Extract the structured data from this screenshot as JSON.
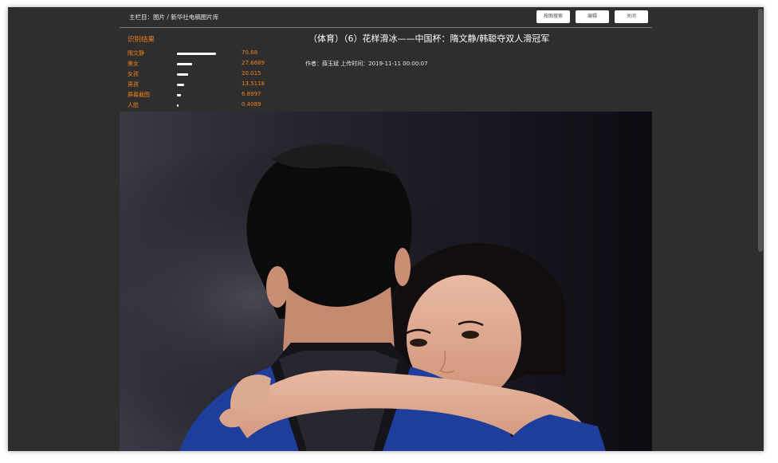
{
  "header": {
    "breadcrumb": "主栏目：图片 / 新华社电稿图片库",
    "buttons": {
      "search": "按图搜索",
      "edit": "编辑",
      "close": "关闭"
    }
  },
  "recognition": {
    "title": "识别结果",
    "items": [
      {
        "label": "隋文静",
        "value": "70.68",
        "score": 0.7068
      },
      {
        "label": "美女",
        "value": "27.6689",
        "score": 0.276689
      },
      {
        "label": "女孩",
        "value": "20.015",
        "score": 0.20015
      },
      {
        "label": "男孩",
        "value": "13.5118",
        "score": 0.135118
      },
      {
        "label": "屏幕截图",
        "value": "6.8997",
        "score": 0.068997
      },
      {
        "label": "人脸",
        "value": "0.4089",
        "score": 0.004089
      }
    ]
  },
  "article": {
    "title": "（体育）（6）花样滑冰——中国杯：隋文静/韩聪夺双人滑冠军",
    "meta": "作者：薛玉斌  上传时间：2019-11-11 00:00:07"
  },
  "colors": {
    "accent": "#f07f1c",
    "background": "#2e2e2e",
    "bar": "#ffffff"
  }
}
